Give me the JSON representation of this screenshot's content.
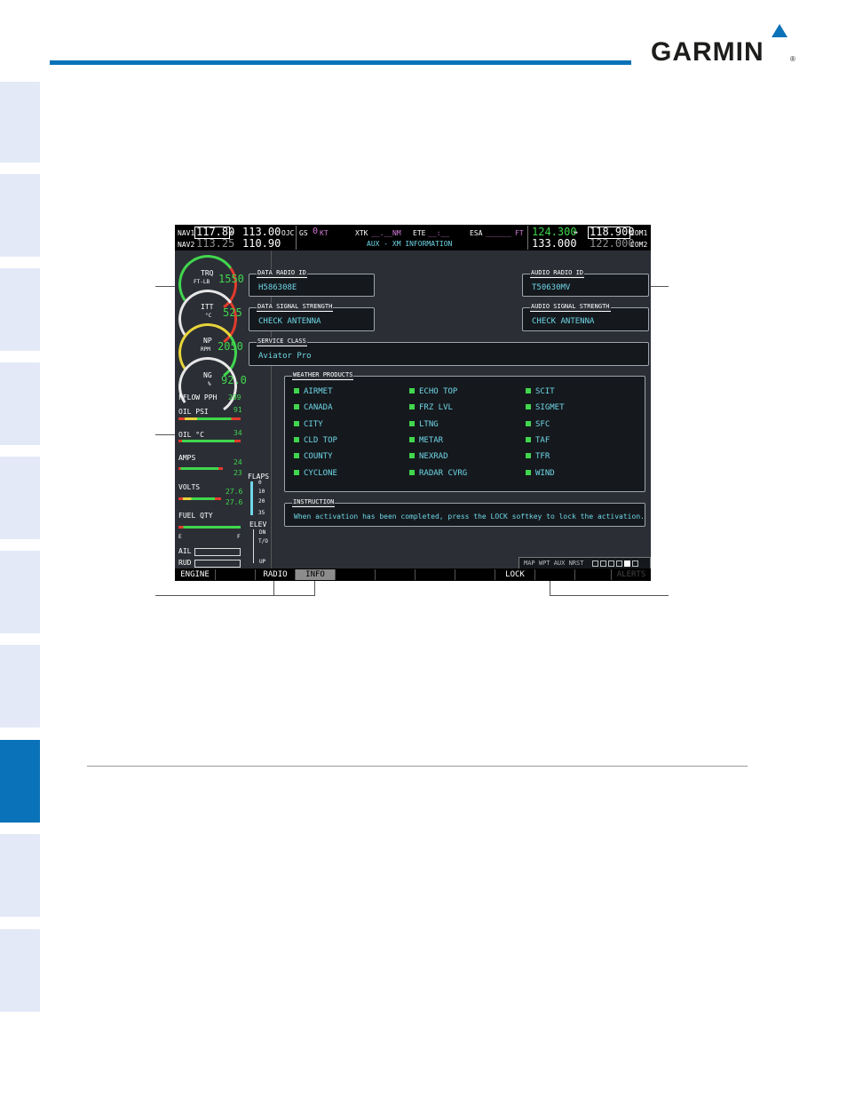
{
  "brand": {
    "name": "GARMIN",
    "reg": "®"
  },
  "top": {
    "nav1_label": "NAV1",
    "nav1_active": "117.80",
    "nav1_standby": "113.00",
    "nav1_id": "OJC",
    "nav2_label": "NAV2",
    "nav2_active": "113.25",
    "nav2_standby": "110.90",
    "swap_arrow": "↔",
    "gs_label": "GS",
    "gs_value": "0",
    "gs_unit": "KT",
    "xtk_label": "XTK",
    "xtk_value": "__.__",
    "xtk_unit": "NM",
    "ete_label": "ETE",
    "ete_value": "__:__",
    "esa_label": "ESA",
    "esa_value": "______",
    "esa_unit": "FT",
    "page_title": "AUX - XM INFORMATION",
    "com1_active": "124.300",
    "com1_standby": "118.900",
    "com1_label": "COM1",
    "com2_active": "133.000",
    "com2_standby": "122.000",
    "com2_label": "COM2"
  },
  "eis": {
    "trq_label": "TRQ",
    "trq_unit": "FT-LB",
    "trq_value": "1550",
    "itt_label": "ITT",
    "itt_unit": "°C",
    "itt_value": "525",
    "np_label": "NP",
    "np_unit": "RPM",
    "np_value": "2050",
    "ng_label": "NG",
    "ng_unit": "%",
    "ng_value": "92.0",
    "fflow_label": "FFLOW PPH",
    "fflow_value": "289",
    "oilpsi_label": "OIL PSI",
    "oilpsi_value": "91",
    "oilc_label": "OIL °C",
    "oilc_value": "34",
    "amps_label": "AMPS",
    "amps_value1": "24",
    "amps_value2": "23",
    "volts_label": "VOLTS",
    "volts_value1": "27.6",
    "volts_value2": "27.6",
    "fuel_label": "FUEL QTY",
    "fuel_e": "E",
    "fuel_f": "F",
    "ail_label": "AIL",
    "rud_label": "RUD",
    "flaps_label": "FLAPS",
    "flaps_marks": [
      "0",
      "10",
      "20",
      "35"
    ],
    "elev_label": "ELEV",
    "elev_dn": "DN",
    "elev_to": "T/O",
    "elev_up": "UP"
  },
  "panels": {
    "data_radio_id": {
      "label": "DATA RADIO ID",
      "value": "H586308E"
    },
    "audio_radio_id": {
      "label": "AUDIO RADIO ID",
      "value": "T50630MV"
    },
    "data_signal": {
      "label": "DATA SIGNAL STRENGTH",
      "value": "CHECK ANTENNA"
    },
    "audio_signal": {
      "label": "AUDIO SIGNAL STRENGTH",
      "value": "CHECK ANTENNA"
    },
    "service_class": {
      "label": "SERVICE CLASS",
      "value": "Aviator Pro"
    },
    "weather": {
      "label": "WEATHER PRODUCTS",
      "col1": [
        "AIRMET",
        "CANADA",
        "CITY",
        "CLD TOP",
        "COUNTY",
        "CYCLONE"
      ],
      "col2": [
        "ECHO TOP",
        "FRZ LVL",
        "LTNG",
        "METAR",
        "NEXRAD",
        "RADAR CVRG"
      ],
      "col3": [
        "SCIT",
        "SIGMET",
        "SFC",
        "TAF",
        "TFR",
        "WIND"
      ]
    },
    "instruction": {
      "label": "INSTRUCTION",
      "value": "When activation has been completed, press the LOCK softkey to lock the activation."
    }
  },
  "page_group": {
    "text": "MAP WPT AUX NRST"
  },
  "softkeys": [
    "ENGINE",
    "",
    "RADIO",
    "INFO",
    "",
    "",
    "",
    "",
    "LOCK",
    "",
    "",
    "ALERTS"
  ]
}
